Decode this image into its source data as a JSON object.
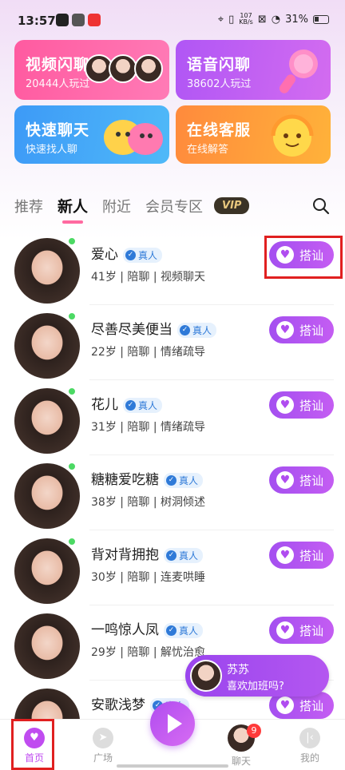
{
  "status_bar": {
    "time": "13:57",
    "net_speed": "107\nKB/s",
    "battery": "31%"
  },
  "cards": [
    {
      "title": "视频闪聊",
      "subtitle": "20444人玩过"
    },
    {
      "title": "语音闪聊",
      "subtitle": "38602人玩过"
    },
    {
      "title": "快速聊天",
      "subtitle": "快速找人聊"
    },
    {
      "title": "在线客服",
      "subtitle": "在线解答"
    }
  ],
  "tabs": [
    "推荐",
    "新人",
    "附近",
    "会员专区"
  ],
  "active_tab": "新人",
  "vip_label": "VIP",
  "verified_label": "真人",
  "action_label": "搭讪",
  "users": [
    {
      "name": "爱心",
      "info": "41岁 | 陪聊 | 视频聊天"
    },
    {
      "name": "尽善尽美便当",
      "info": "22岁 | 陪聊 | 情绪疏导"
    },
    {
      "name": "花儿",
      "info": "31岁 | 陪聊 | 情绪疏导"
    },
    {
      "name": "糖糖爱吃糖",
      "info": "38岁 | 陪聊 | 树洞倾述"
    },
    {
      "name": "背对背拥抱",
      "info": "30岁 | 陪聊 | 连麦哄睡"
    },
    {
      "name": "一鸣惊人凤",
      "info": "29岁 | 陪聊 | 解忧治愈"
    },
    {
      "name": "安歌浅梦",
      "info": ""
    }
  ],
  "toast": {
    "name": "苏苏",
    "message": "喜欢加班吗?"
  },
  "nav": {
    "home": "首页",
    "square": "广场",
    "chat": "聊天",
    "mine": "我的",
    "chat_badge": "9"
  },
  "colors": {
    "accent": "#b04cf0",
    "online": "#4cd964",
    "verified": "#2f7ad8"
  }
}
